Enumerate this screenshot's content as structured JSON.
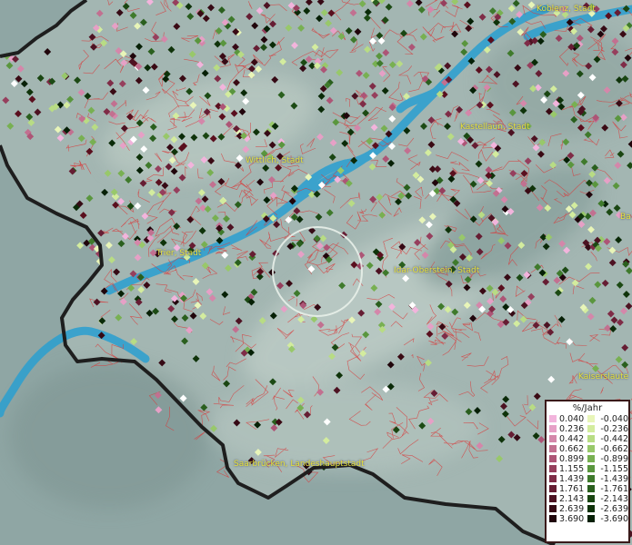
{
  "map": {
    "places": [
      {
        "id": "koblenz",
        "label": "Koblenz, Stadt"
      },
      {
        "id": "kastellaun",
        "label": "Kastellaun, Stadt"
      },
      {
        "id": "wittlich",
        "label": "Wittlich, Stadt"
      },
      {
        "id": "trier",
        "label": "Trier, Stadt"
      },
      {
        "id": "idar-oberstein",
        "label": "Idar-Oberstein, Stadt"
      },
      {
        "id": "kaiserslautern",
        "label": "Kaiserslaute"
      },
      {
        "id": "bad",
        "label": "Ba"
      },
      {
        "id": "saarbruecken",
        "label": "Saarbrücken, Landeshauptstadt"
      }
    ],
    "colors": {
      "land": "#9eb4b1",
      "outside": "#8aa09e",
      "border": "#1e1e1e",
      "rivers": "#2a9fd0",
      "municipal_lines": "#d83a3a",
      "labels": "#e6e23a"
    }
  },
  "legend": {
    "title": "%/Jahr",
    "positive": [
      {
        "value": "0.040",
        "color": "#f2b4dc"
      },
      {
        "value": "0.236",
        "color": "#e6a0c6"
      },
      {
        "value": "0.442",
        "color": "#d487aa"
      },
      {
        "value": "0.662",
        "color": "#c27090"
      },
      {
        "value": "0.899",
        "color": "#ad5576"
      },
      {
        "value": "1.155",
        "color": "#963f5d"
      },
      {
        "value": "1.439",
        "color": "#7f2c47"
      },
      {
        "value": "1.761",
        "color": "#661d33"
      },
      {
        "value": "2.143",
        "color": "#4d1222"
      },
      {
        "value": "2.639",
        "color": "#360a15"
      },
      {
        "value": "3.690",
        "color": "#20050b"
      }
    ],
    "negative": [
      {
        "value": "-0.040",
        "color": "#e8f5b8"
      },
      {
        "value": "-0.236",
        "color": "#d3ec9e"
      },
      {
        "value": "-0.442",
        "color": "#b8dc84"
      },
      {
        "value": "-0.662",
        "color": "#98c86a"
      },
      {
        "value": "-0.899",
        "color": "#78b052"
      },
      {
        "value": "-1.155",
        "color": "#5a963e"
      },
      {
        "value": "-1.439",
        "color": "#3f7a2c"
      },
      {
        "value": "-1.761",
        "color": "#2a5f1e"
      },
      {
        "value": "-2.143",
        "color": "#1a4612"
      },
      {
        "value": "-2.639",
        "color": "#0f330a"
      },
      {
        "value": "-3.690",
        "color": "#062006"
      }
    ]
  }
}
